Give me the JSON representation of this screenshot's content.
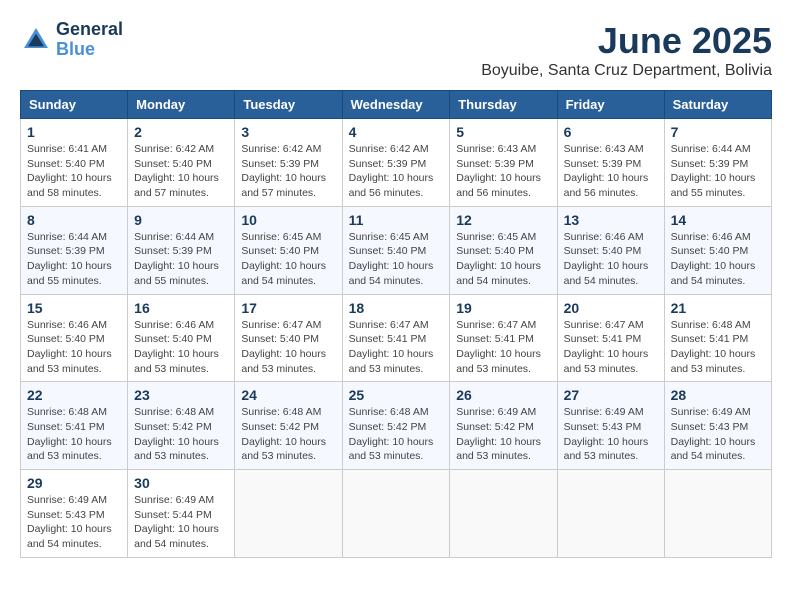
{
  "logo": {
    "line1": "General",
    "line2": "Blue"
  },
  "title": "June 2025",
  "location": "Boyuibe, Santa Cruz Department, Bolivia",
  "header": {
    "days": [
      "Sunday",
      "Monday",
      "Tuesday",
      "Wednesday",
      "Thursday",
      "Friday",
      "Saturday"
    ]
  },
  "weeks": [
    [
      {
        "day": "1",
        "sunrise": "6:41 AM",
        "sunset": "5:40 PM",
        "daylight": "10 hours and 58 minutes."
      },
      {
        "day": "2",
        "sunrise": "6:42 AM",
        "sunset": "5:40 PM",
        "daylight": "10 hours and 57 minutes."
      },
      {
        "day": "3",
        "sunrise": "6:42 AM",
        "sunset": "5:39 PM",
        "daylight": "10 hours and 57 minutes."
      },
      {
        "day": "4",
        "sunrise": "6:42 AM",
        "sunset": "5:39 PM",
        "daylight": "10 hours and 56 minutes."
      },
      {
        "day": "5",
        "sunrise": "6:43 AM",
        "sunset": "5:39 PM",
        "daylight": "10 hours and 56 minutes."
      },
      {
        "day": "6",
        "sunrise": "6:43 AM",
        "sunset": "5:39 PM",
        "daylight": "10 hours and 56 minutes."
      },
      {
        "day": "7",
        "sunrise": "6:44 AM",
        "sunset": "5:39 PM",
        "daylight": "10 hours and 55 minutes."
      }
    ],
    [
      {
        "day": "8",
        "sunrise": "6:44 AM",
        "sunset": "5:39 PM",
        "daylight": "10 hours and 55 minutes."
      },
      {
        "day": "9",
        "sunrise": "6:44 AM",
        "sunset": "5:39 PM",
        "daylight": "10 hours and 55 minutes."
      },
      {
        "day": "10",
        "sunrise": "6:45 AM",
        "sunset": "5:40 PM",
        "daylight": "10 hours and 54 minutes."
      },
      {
        "day": "11",
        "sunrise": "6:45 AM",
        "sunset": "5:40 PM",
        "daylight": "10 hours and 54 minutes."
      },
      {
        "day": "12",
        "sunrise": "6:45 AM",
        "sunset": "5:40 PM",
        "daylight": "10 hours and 54 minutes."
      },
      {
        "day": "13",
        "sunrise": "6:46 AM",
        "sunset": "5:40 PM",
        "daylight": "10 hours and 54 minutes."
      },
      {
        "day": "14",
        "sunrise": "6:46 AM",
        "sunset": "5:40 PM",
        "daylight": "10 hours and 54 minutes."
      }
    ],
    [
      {
        "day": "15",
        "sunrise": "6:46 AM",
        "sunset": "5:40 PM",
        "daylight": "10 hours and 53 minutes."
      },
      {
        "day": "16",
        "sunrise": "6:46 AM",
        "sunset": "5:40 PM",
        "daylight": "10 hours and 53 minutes."
      },
      {
        "day": "17",
        "sunrise": "6:47 AM",
        "sunset": "5:40 PM",
        "daylight": "10 hours and 53 minutes."
      },
      {
        "day": "18",
        "sunrise": "6:47 AM",
        "sunset": "5:41 PM",
        "daylight": "10 hours and 53 minutes."
      },
      {
        "day": "19",
        "sunrise": "6:47 AM",
        "sunset": "5:41 PM",
        "daylight": "10 hours and 53 minutes."
      },
      {
        "day": "20",
        "sunrise": "6:47 AM",
        "sunset": "5:41 PM",
        "daylight": "10 hours and 53 minutes."
      },
      {
        "day": "21",
        "sunrise": "6:48 AM",
        "sunset": "5:41 PM",
        "daylight": "10 hours and 53 minutes."
      }
    ],
    [
      {
        "day": "22",
        "sunrise": "6:48 AM",
        "sunset": "5:41 PM",
        "daylight": "10 hours and 53 minutes."
      },
      {
        "day": "23",
        "sunrise": "6:48 AM",
        "sunset": "5:42 PM",
        "daylight": "10 hours and 53 minutes."
      },
      {
        "day": "24",
        "sunrise": "6:48 AM",
        "sunset": "5:42 PM",
        "daylight": "10 hours and 53 minutes."
      },
      {
        "day": "25",
        "sunrise": "6:48 AM",
        "sunset": "5:42 PM",
        "daylight": "10 hours and 53 minutes."
      },
      {
        "day": "26",
        "sunrise": "6:49 AM",
        "sunset": "5:42 PM",
        "daylight": "10 hours and 53 minutes."
      },
      {
        "day": "27",
        "sunrise": "6:49 AM",
        "sunset": "5:43 PM",
        "daylight": "10 hours and 53 minutes."
      },
      {
        "day": "28",
        "sunrise": "6:49 AM",
        "sunset": "5:43 PM",
        "daylight": "10 hours and 54 minutes."
      }
    ],
    [
      {
        "day": "29",
        "sunrise": "6:49 AM",
        "sunset": "5:43 PM",
        "daylight": "10 hours and 54 minutes."
      },
      {
        "day": "30",
        "sunrise": "6:49 AM",
        "sunset": "5:44 PM",
        "daylight": "10 hours and 54 minutes."
      },
      null,
      null,
      null,
      null,
      null
    ]
  ]
}
